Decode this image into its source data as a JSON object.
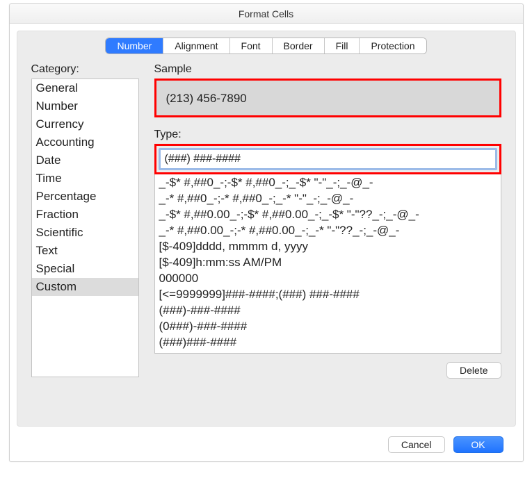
{
  "dialog": {
    "title": "Format Cells"
  },
  "tabs": {
    "number": "Number",
    "alignment": "Alignment",
    "font": "Font",
    "border": "Border",
    "fill": "Fill",
    "protection": "Protection"
  },
  "labels": {
    "category": "Category:",
    "sample": "Sample",
    "type": "Type:"
  },
  "category_items": [
    "General",
    "Number",
    "Currency",
    "Accounting",
    "Date",
    "Time",
    "Percentage",
    "Fraction",
    "Scientific",
    "Text",
    "Special",
    "Custom"
  ],
  "category_selected_index": 11,
  "sample_value": "(213) 456-7890",
  "type_value": "(###) ###-####",
  "format_list": [
    "_-$* #,##0_-;-$* #,##0_-;_-$* \"-\"_-;_-@_-",
    "_-* #,##0_-;-* #,##0_-;_-* \"-\"_-;_-@_-",
    "_-$* #,##0.00_-;-$* #,##0.00_-;_-$* \"-\"??_-;_-@_-",
    "_-* #,##0.00_-;-* #,##0.00_-;_-* \"-\"??_-;_-@_-",
    "[$-409]dddd, mmmm d, yyyy",
    "[$-409]h:mm:ss AM/PM",
    "000000",
    "[<=9999999]###-####;(###) ###-####",
    "(###)-###-####",
    "(0###)-###-####",
    "(###)###-####"
  ],
  "buttons": {
    "delete": "Delete",
    "cancel": "Cancel",
    "ok": "OK"
  }
}
